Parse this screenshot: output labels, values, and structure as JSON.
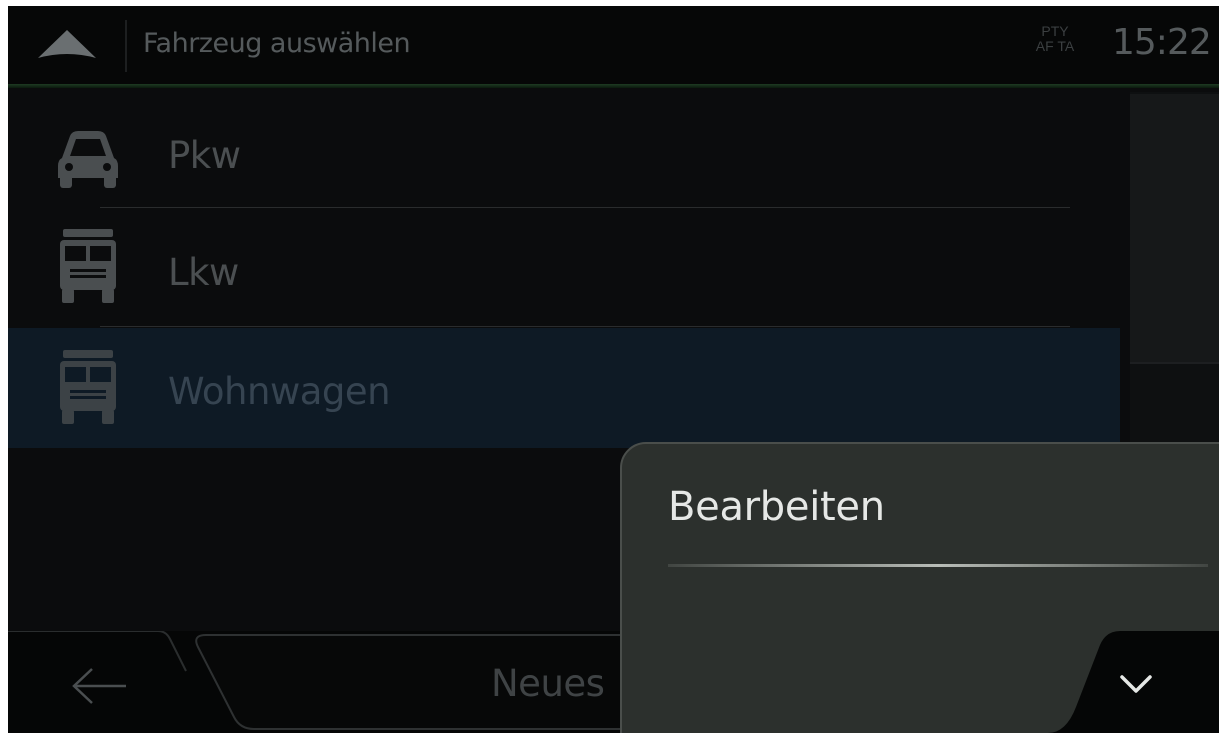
{
  "header": {
    "title": "Fahrzeug auswählen",
    "rds_line1": "PTY",
    "rds_line2": "AF TA",
    "clock": "15:22",
    "nav_icon": "navigation-arrow-icon"
  },
  "vehicles": [
    {
      "label": "Pkw",
      "icon": "car-icon"
    },
    {
      "label": "Lkw",
      "icon": "truck-icon"
    },
    {
      "label": "Wohnwagen",
      "icon": "camper-icon",
      "selected": true
    }
  ],
  "bottom_bar": {
    "back_icon": "back-arrow-icon",
    "new_label": "Neues"
  },
  "popup_menu": {
    "items": [
      {
        "label": "Bearbeiten"
      }
    ],
    "collapse_icon": "chevron-down-icon"
  },
  "colors": {
    "background": "#0b0c0d",
    "selected_row": "#0e1a25",
    "popup": "#2c302d",
    "accent_line": "#1f3b23"
  }
}
